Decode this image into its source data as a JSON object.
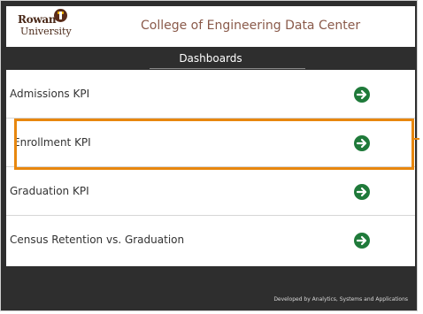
{
  "header": {
    "logo_word_1": "Rowan",
    "logo_word_2": "University",
    "title": "College of Engineering Data Center"
  },
  "section_title": "Dashboards",
  "dashboards": [
    {
      "label": "Admissions KPI",
      "icon": "arrow-right-circle-icon"
    },
    {
      "label": "Enrollment KPI",
      "icon": "arrow-right-circle-icon"
    },
    {
      "label": "Graduation KPI",
      "icon": "arrow-right-circle-icon"
    },
    {
      "label": "Census Retention vs. Graduation",
      "icon": "arrow-right-circle-icon"
    }
  ],
  "footer": {
    "credit": "Developed by Analytics, Systems and Applications"
  },
  "colors": {
    "background": "#2e2e2e",
    "title": "#8a5a4a",
    "arrow": "#1f7a3a",
    "highlight": "#e8870e",
    "brand_brown": "#5a2c1a",
    "brand_gold": "#f2b400"
  }
}
